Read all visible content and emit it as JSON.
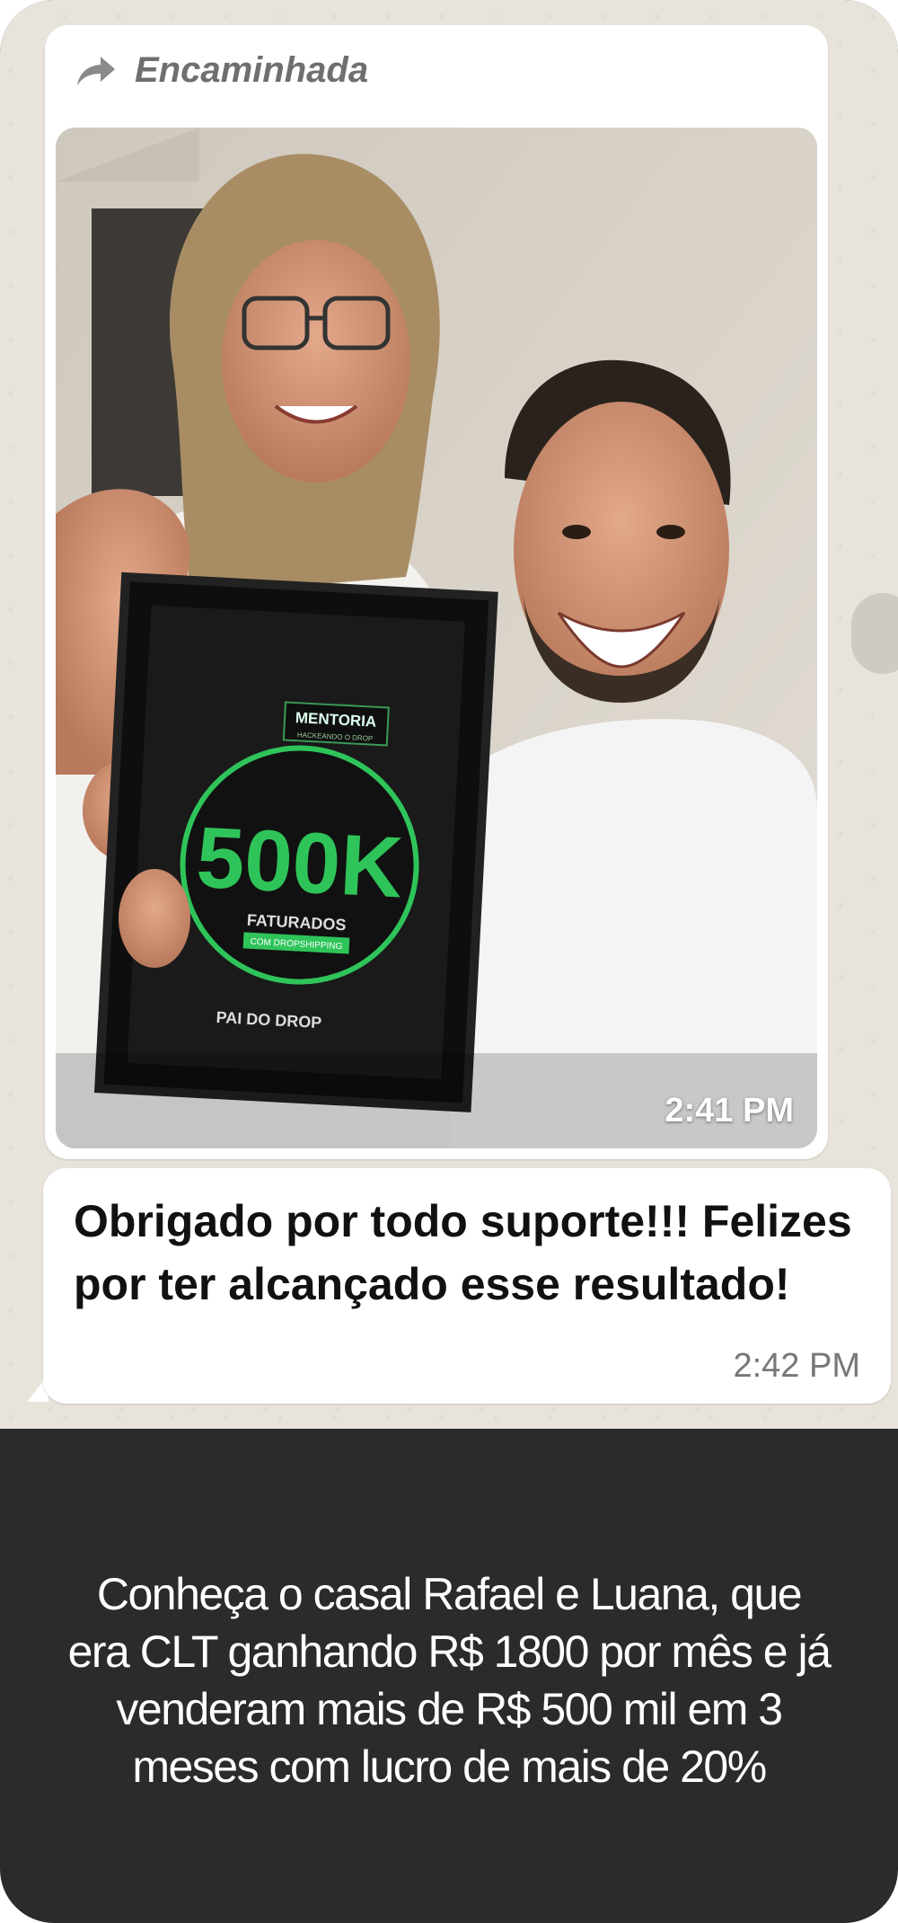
{
  "forwarded": {
    "label": "Encaminhada",
    "icon": "forward-arrow-icon"
  },
  "photo_message": {
    "time": "2:41 PM",
    "plaque": {
      "brand_line1": "MENTORIA",
      "brand_line2": "HACKEANDO O DROP",
      "amount": "500K",
      "subtitle": "FATURADOS",
      "sub_badge": "COM DROPSHIPPING",
      "footer": "PAI DO DROP"
    }
  },
  "text_message": {
    "text": "Obrigado por todo suporte!!! Felizes por ter alcançado esse resultado!",
    "time": "2:42 PM"
  },
  "caption": {
    "text": "Conheça o casal Rafael e Luana, que era CLT ganhando R$ 1800 por mês e já venderam mais de R$ 500 mil em 3 meses com lucro de mais de 20%"
  },
  "colors": {
    "accent_green": "#2fc45a",
    "bubble_bg": "#ffffff",
    "caption_bg": "#2b2b2b"
  }
}
